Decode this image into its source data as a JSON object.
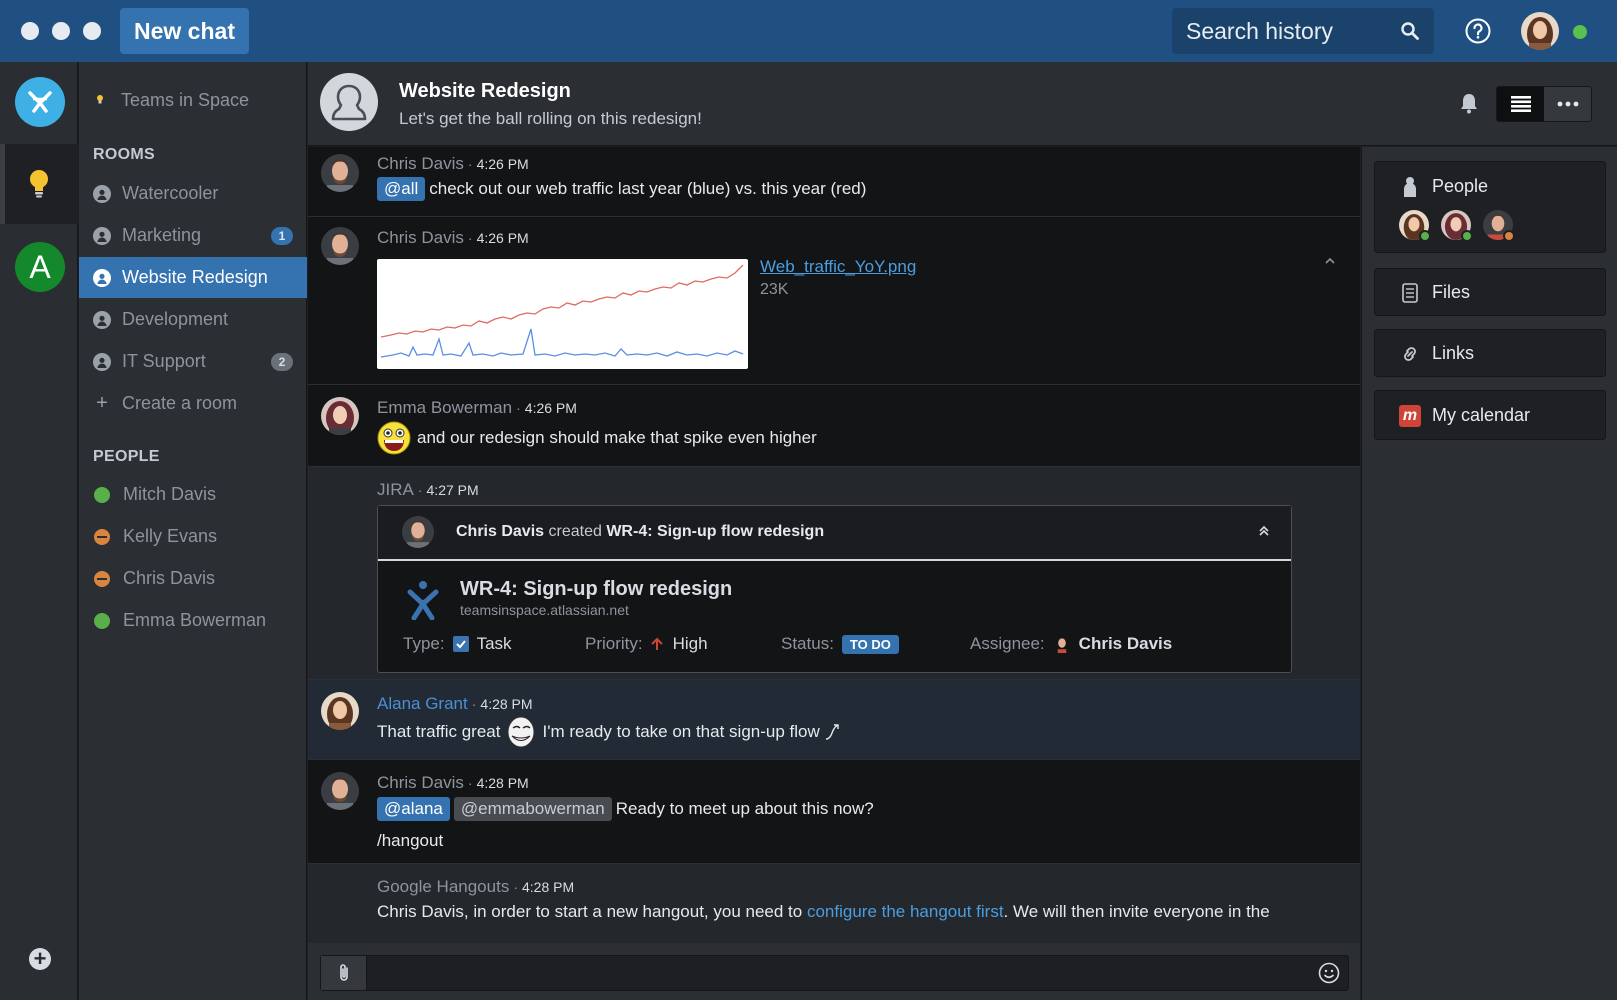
{
  "titlebar": {
    "new_chat_label": "New chat",
    "search_placeholder": "Search history"
  },
  "team": {
    "name": "Teams in Space"
  },
  "sidebar": {
    "rooms_title": "ROOMS",
    "rooms": [
      {
        "label": "Watercooler"
      },
      {
        "label": "Marketing",
        "badge": "1"
      },
      {
        "label": "Website Redesign",
        "active": true
      },
      {
        "label": "Development"
      },
      {
        "label": "IT Support",
        "badge": "2"
      }
    ],
    "create_room_label": "Create a room",
    "people_title": "PEOPLE",
    "people": [
      {
        "label": "Mitch Davis",
        "status": "online"
      },
      {
        "label": "Kelly Evans",
        "status": "away"
      },
      {
        "label": "Chris Davis",
        "status": "away"
      },
      {
        "label": "Emma Bowerman",
        "status": "online"
      }
    ]
  },
  "room": {
    "title": "Website Redesign",
    "topic": "Let's get the ball rolling on this redesign!"
  },
  "messages": {
    "m1": {
      "name": "Chris Davis",
      "time": "4:26 PM",
      "mention": "@all",
      "text": "check out our web traffic last year (blue) vs. this year (red)"
    },
    "m2": {
      "name": "Chris Davis",
      "time": "4:26 PM",
      "file_name": "Web_traffic_YoY.png",
      "file_size": "23K"
    },
    "m3": {
      "name": "Emma Bowerman",
      "time": "4:26 PM",
      "text": "and our redesign should make that spike even higher"
    },
    "m4": {
      "name": "JIRA",
      "time": "4:27 PM",
      "card_actor": "Chris Davis",
      "card_verb": "created",
      "card_issue": "WR-4: Sign-up flow redesign",
      "issue_title": "WR-4: Sign-up flow redesign",
      "issue_url": "teamsinspace.atlassian.net",
      "type_label": "Type:",
      "type_value": "Task",
      "priority_label": "Priority:",
      "priority_value": "High",
      "status_label": "Status:",
      "status_value": "TO DO",
      "assignee_label": "Assignee:",
      "assignee_value": "Chris Davis"
    },
    "m5": {
      "name": "Alana Grant",
      "time": "4:28 PM",
      "text_before": "That traffic great",
      "text_after": "I'm ready to take on that sign-up flow"
    },
    "m6": {
      "name": "Chris Davis",
      "time": "4:28 PM",
      "mention1": "@alana",
      "mention2": "@emmabowerman",
      "text": "Ready to meet up about this now?",
      "line2": "/hangout"
    },
    "m7": {
      "name": "Google Hangouts",
      "time": "4:28 PM",
      "text_before": "Chris Davis, in order to start a new hangout, you need to",
      "link": "configure the hangout first",
      "text_after": ". We will then invite everyone in the"
    }
  },
  "right_panel": {
    "people_label": "People",
    "files_label": "Files",
    "links_label": "Links",
    "calendar_label": "My calendar",
    "calendar_logo": "m"
  },
  "rail": {
    "team_initial": "A"
  },
  "colors": {
    "titlebar": "#205081",
    "accent": "#3572b0",
    "online": "#59b04a",
    "away": "#d9843f",
    "chart_last_year": "#5b8ee6",
    "chart_this_year": "#e06a63"
  }
}
